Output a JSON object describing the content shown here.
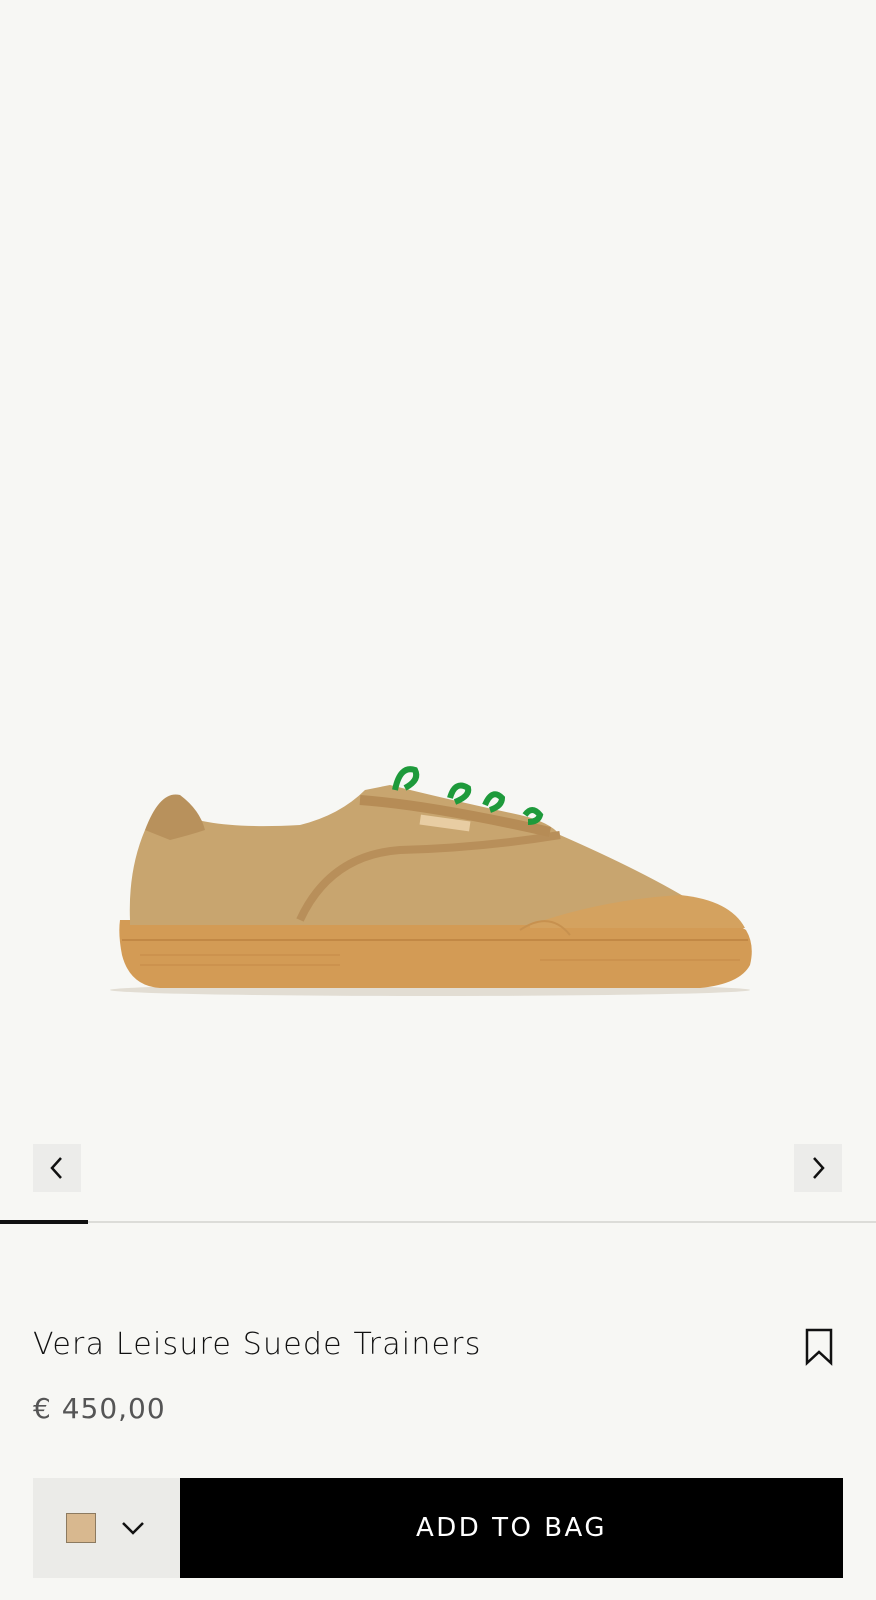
{
  "product": {
    "title": "Vera Leisure Suede Trainers",
    "price": "€ 450,00",
    "image_icon": "sneaker-image"
  },
  "gallery": {
    "prev_icon": "chevron-left-icon",
    "next_icon": "chevron-right-icon",
    "progress": 0.1
  },
  "actions": {
    "bookmark_icon": "bookmark-icon",
    "add_to_bag_label": "ADD TO BAG"
  },
  "color_select": {
    "swatch_color": "#d8b88f",
    "chevron_icon": "chevron-down-icon"
  },
  "colors": {
    "background": "#f7f7f4",
    "button_bg": "#000000",
    "button_text": "#ffffff",
    "lace_green": "#1e9a3b"
  }
}
